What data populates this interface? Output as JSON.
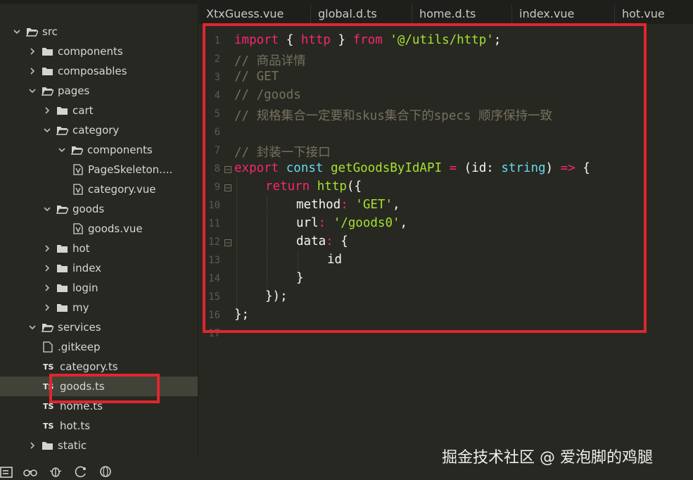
{
  "tabs": [
    {
      "label": "XtxGuess.vue"
    },
    {
      "label": "global.d.ts"
    },
    {
      "label": "home.d.ts"
    },
    {
      "label": "index.vue"
    },
    {
      "label": "hot.vue"
    }
  ],
  "tree": [
    {
      "label": "src",
      "kind": "folder-open"
    },
    {
      "label": "components",
      "kind": "folder"
    },
    {
      "label": "composables",
      "kind": "folder"
    },
    {
      "label": "pages",
      "kind": "folder-open"
    },
    {
      "label": "cart",
      "kind": "folder"
    },
    {
      "label": "category",
      "kind": "folder-open"
    },
    {
      "label": "components",
      "kind": "folder-open"
    },
    {
      "label": "PageSkeleton....",
      "kind": "vue"
    },
    {
      "label": "category.vue",
      "kind": "vue"
    },
    {
      "label": "goods",
      "kind": "folder-open"
    },
    {
      "label": "goods.vue",
      "kind": "vue"
    },
    {
      "label": "hot",
      "kind": "folder"
    },
    {
      "label": "index",
      "kind": "folder"
    },
    {
      "label": "login",
      "kind": "folder"
    },
    {
      "label": "my",
      "kind": "folder"
    },
    {
      "label": "services",
      "kind": "folder-open"
    },
    {
      "label": ".gitkeep",
      "kind": "file"
    },
    {
      "label": "category.ts",
      "kind": "ts"
    },
    {
      "label": "goods.ts",
      "kind": "ts",
      "selected": true
    },
    {
      "label": "home.ts",
      "kind": "ts"
    },
    {
      "label": "hot.ts",
      "kind": "ts"
    },
    {
      "label": "static",
      "kind": "folder"
    }
  ],
  "ts_badge": "TS",
  "line_numbers": [
    "1",
    "2",
    "3",
    "4",
    "5",
    "6",
    "7",
    "8",
    "9",
    "10",
    "11",
    "12",
    "13",
    "14",
    "15",
    "16",
    "17"
  ],
  "code": {
    "l1": {
      "import": "import",
      "brace_open": " { ",
      "http": "http",
      "brace_close": " } ",
      "from": "from",
      "path": " '@/utils/http'",
      "semi": ";"
    },
    "l2": "// 商品详情",
    "l3": "// GET",
    "l4": "// /goods",
    "l5": "// 规格集合一定要和skus集合下的specs 顺序保持一致",
    "l7": "// 封装一下接口",
    "l8": {
      "export": "export",
      "const": " const ",
      "name": "getGoodsByIdAPI",
      "eq": " = ",
      "paren": "(id: ",
      "type": "string",
      "arrow_pre": ") ",
      "arrow": "=>",
      "open": " {"
    },
    "l9": {
      "return": "return",
      "call": " http",
      "open": "({"
    },
    "l10": {
      "key": "method",
      "colon": ": ",
      "val": "'GET'",
      "comma": ","
    },
    "l11": {
      "key": "url",
      "colon": ": ",
      "val": "'/goods0'",
      "comma": ","
    },
    "l12": {
      "key": "data",
      "colon": ": ",
      "open": "{"
    },
    "l13": "id",
    "l14": "}",
    "l15": "});",
    "l16": "};"
  },
  "watermark": "掘金技术社区 @ 爱泡脚的鸡腿",
  "colors": {
    "highlight_box": "#e0262e",
    "editor_bg": "#272822",
    "selected_row": "#414339"
  }
}
